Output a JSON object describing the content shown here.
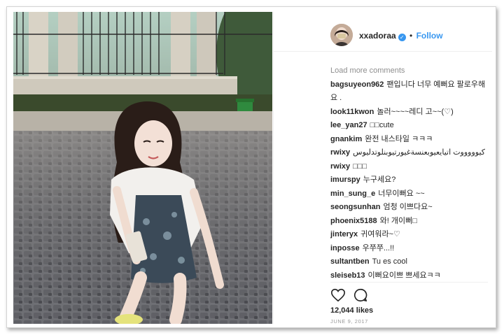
{
  "post": {
    "username": "xxadoraa",
    "separator": "•",
    "follow_label": "Follow",
    "verified_icon": "check-badge-icon",
    "load_more_label": "Load more comments",
    "comments": [
      {
        "user": "bagsuyeon962",
        "text": "팬입니다 너무 예뻐요 팔로우해요 ."
      },
      {
        "user": "look11kwon",
        "text": "놀러~~~~레디 고~~(♡)"
      },
      {
        "user": "lee_yan27",
        "text": "□□cute"
      },
      {
        "user": "gnankim",
        "text": "완전 내스타일 ㅋㅋㅋ"
      },
      {
        "user": "rwixy",
        "text": "كيوووووت اتيايعيوبعنسةغيورتيوبنلوتدليوس"
      },
      {
        "user": "rwixy",
        "text": "□□□"
      },
      {
        "user": "imurspy",
        "text": "누구세요?"
      },
      {
        "user": "min_sung_e",
        "text": "너무이뻐요 ~~"
      },
      {
        "user": "seongsunhan",
        "text": "엄청 이쁘다요~"
      },
      {
        "user": "phoenix5188",
        "text": "와! 개이뻐□"
      },
      {
        "user": "jinteryx",
        "text": "귀여워라~♡"
      },
      {
        "user": "inposse",
        "text": "우쭈쭈...!!"
      },
      {
        "user": "sultantben",
        "text": "Tu es cool"
      },
      {
        "user": "sleiseb13",
        "text": "이뻐요이쁘 쁘세요ㅋㅋ"
      }
    ],
    "likes": "12,044 likes",
    "date": "JUNE 9, 2017"
  },
  "icons": {
    "like": "heart-icon",
    "comment": "comment-bubble-icon"
  },
  "colors": {
    "accent": "#3897f0",
    "text": "#262626",
    "muted": "#8e8e8e"
  }
}
